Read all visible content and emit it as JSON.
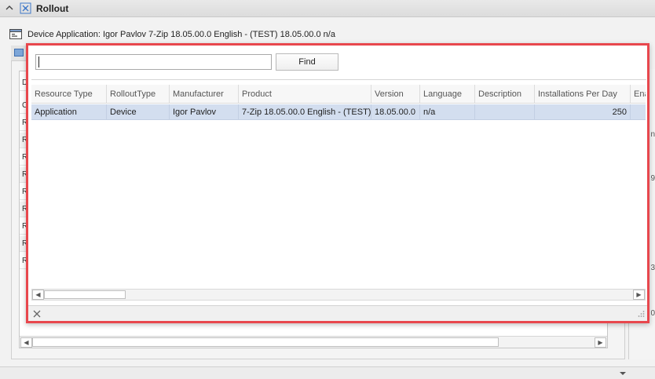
{
  "header": {
    "title": "Rollout"
  },
  "device_application": {
    "label": "Device Application: Igor Pavlov 7-Zip 18.05.00.0 English - (TEST) 18.05.00.0 n/a"
  },
  "popup": {
    "search": {
      "value": "",
      "placeholder": ""
    },
    "find_label": "Find",
    "columns": [
      "Resource Type",
      "RolloutType",
      "Manufacturer",
      "Product",
      "Version",
      "Language",
      "Description",
      "Installations Per Day",
      "Ena"
    ],
    "rows": [
      [
        "Application",
        "Device",
        "Igor Pavlov",
        "7-Zip 18.05.00.0 English - (TEST)",
        "18.05.00.0",
        "n/a",
        "",
        "250",
        ""
      ]
    ]
  },
  "background": {
    "row_stubs": [
      "D",
      "C",
      "R",
      "R",
      "R",
      "R",
      "R",
      "R",
      "R",
      "R",
      "R"
    ],
    "right_fragments": [
      "n",
      "9",
      "3",
      "0"
    ]
  },
  "colors": {
    "accent_border": "#e8474d",
    "selected_row": "#d3deef"
  }
}
